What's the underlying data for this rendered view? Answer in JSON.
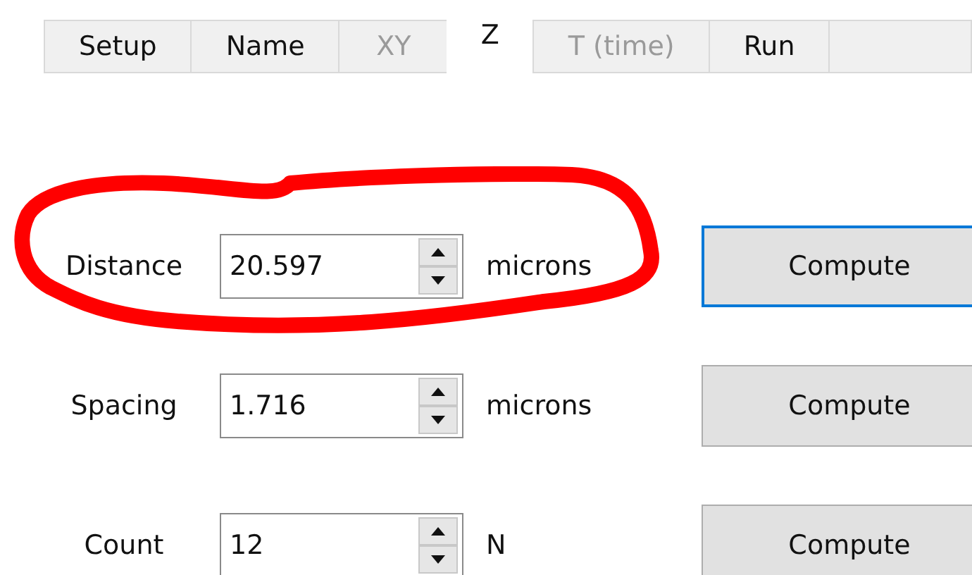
{
  "tabs": [
    {
      "label": "Setup",
      "selected": false,
      "disabled": false
    },
    {
      "label": "Name",
      "selected": false,
      "disabled": false
    },
    {
      "label": "XY",
      "selected": false,
      "disabled": true
    },
    {
      "label": "Z",
      "selected": true,
      "disabled": false
    },
    {
      "label": "T (time)",
      "selected": false,
      "disabled": true
    },
    {
      "label": "Run",
      "selected": false,
      "disabled": false
    }
  ],
  "rows": [
    {
      "label": "Distance",
      "value": "20.597",
      "unit": "microns",
      "button": "Compute",
      "focused": true
    },
    {
      "label": "Spacing",
      "value": "1.716",
      "unit": "microns",
      "button": "Compute",
      "focused": false
    },
    {
      "label": "Count",
      "value": "12",
      "unit": "N",
      "button": "Compute",
      "focused": false
    }
  ]
}
